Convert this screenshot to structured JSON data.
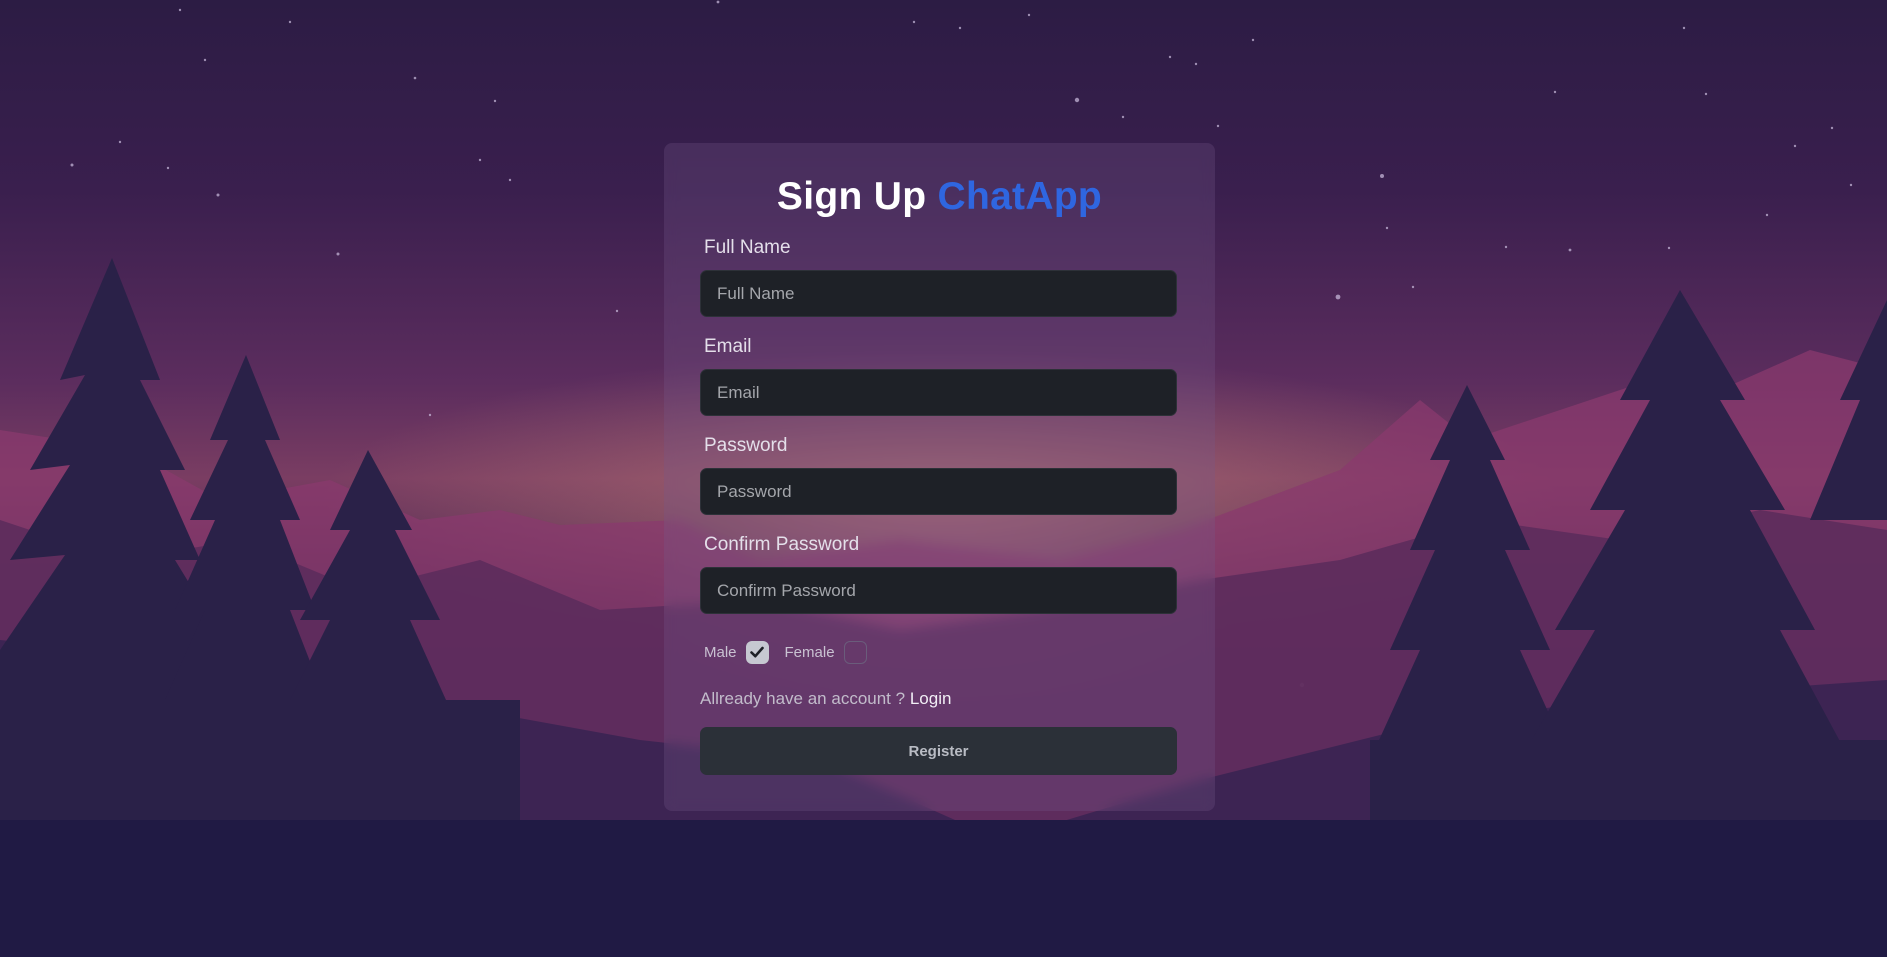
{
  "form": {
    "title_main": "Sign Up",
    "title_brand": "ChatApp",
    "fields": [
      {
        "label": "Full Name",
        "placeholder": "Full Name",
        "value": ""
      },
      {
        "label": "Email",
        "placeholder": "Email",
        "value": ""
      },
      {
        "label": "Password",
        "placeholder": "Password",
        "value": ""
      },
      {
        "label": "Confirm Password",
        "placeholder": "Confirm Password",
        "value": ""
      }
    ],
    "gender": {
      "male_label": "Male",
      "male_checked": true,
      "female_label": "Female",
      "female_checked": false
    },
    "login_prompt": "Allready have an account ?",
    "login_link": "Login",
    "register_label": "Register"
  },
  "icons": {
    "checkmark": "check-icon"
  },
  "colors": {
    "brand": "#2f66e0",
    "input_bg": "#1e2127",
    "button_bg": "#2b3038"
  }
}
